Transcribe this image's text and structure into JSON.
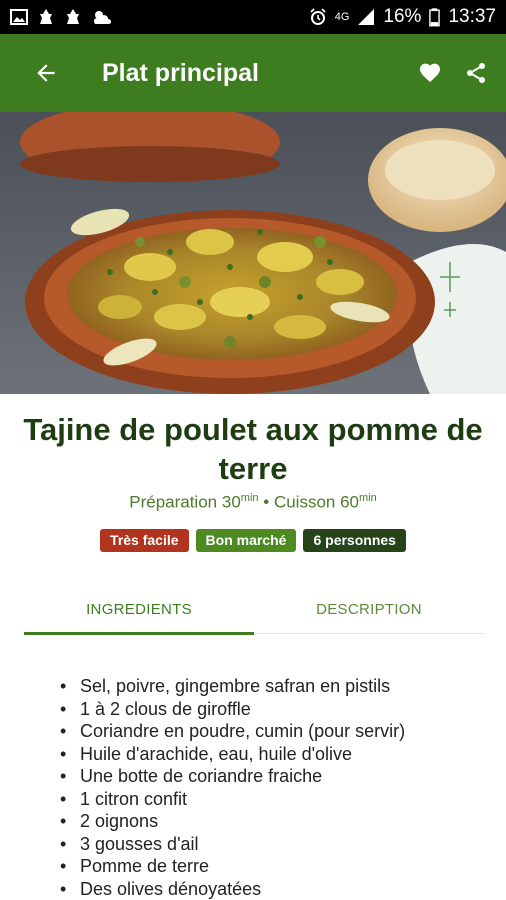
{
  "status_bar": {
    "network": "4G",
    "battery": "16%",
    "time": "13:37"
  },
  "app_bar": {
    "title": "Plat principal"
  },
  "recipe": {
    "title": "Tajine de poulet aux pomme de terre",
    "prep_label": "Préparation",
    "prep_value": "30",
    "prep_unit": "min",
    "separator": "•",
    "cook_label": "Cuisson",
    "cook_value": "60",
    "cook_unit": "min",
    "badges": [
      {
        "label": "Très facile",
        "color": "#b1341f"
      },
      {
        "label": "Bon marché",
        "color": "#4e8a22"
      },
      {
        "label": "6 personnes",
        "color": "#27431a"
      }
    ]
  },
  "tabs": [
    {
      "label": "INGREDIENTS",
      "active": true
    },
    {
      "label": "DESCRIPTION",
      "active": false
    }
  ],
  "ingredients": [
    "Sel, poivre, gingembre safran en pistils",
    "1 à 2 clous de giroffle",
    "Coriandre en poudre, cumin (pour servir)",
    "Huile d'arachide, eau, huile d'olive",
    "Une botte de coriandre fraiche",
    "1 citron confit",
    "2 oignons",
    "3 gousses d'ail",
    "Pomme de terre",
    "Des olives dénoyatées"
  ],
  "colors": {
    "accent": "#3d7d1f",
    "title_text": "#1e3d12"
  }
}
